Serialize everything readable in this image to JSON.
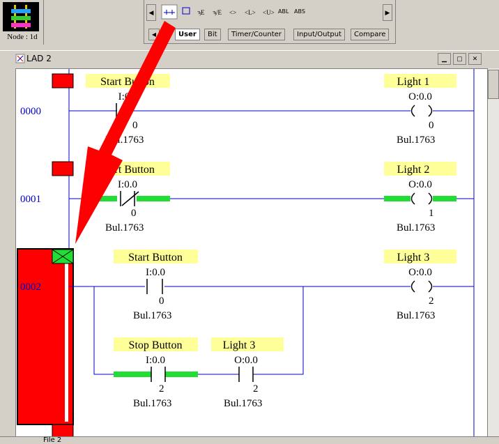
{
  "node": {
    "label": "Node : 1d"
  },
  "instruction_tabs": [
    "User",
    "Bit",
    "Timer/Counter",
    "Input/Output",
    "Compare"
  ],
  "instruction_labels": [
    "ABL",
    "ABS"
  ],
  "window": {
    "title": "LAD 2",
    "file_tab": "File 2"
  },
  "rungs": [
    {
      "number": "0000",
      "input_label": "Start Button",
      "input_addr": "I:0",
      "input_bit": "0",
      "input_bul": "Bul.1763",
      "output_label": "Light 1",
      "output_addr": "O:0.0",
      "output_bit": "0",
      "output_bul": "Bul.1763"
    },
    {
      "number": "0001",
      "input_label": "Start Button",
      "input_addr": "I:0.0",
      "input_bit": "0",
      "input_bul": "Bul.1763",
      "output_label": "Light 2",
      "output_addr": "O:0.0",
      "output_bit": "1",
      "output_bul": "Bul.1763"
    },
    {
      "number": "0002",
      "input_label": "Start Button",
      "input_addr": "I:0.0",
      "input_bit": "0",
      "input_bul": "Bul.1763",
      "output_label": "Light 3",
      "output_addr": "O:0.0",
      "output_bit": "2",
      "output_bul": "Bul.1763",
      "branch_a_label": "Stop Button",
      "branch_a_addr": "I:0.0",
      "branch_a_bit": "2",
      "branch_a_bul": "Bul.1763",
      "branch_b_label": "Light 3",
      "branch_b_addr": "O:0.0",
      "branch_b_bit": "2",
      "branch_b_bul": "Bul.1763"
    }
  ],
  "colors": {
    "rail": "#0000c8",
    "energized": "#22dd33",
    "label_bg": "#ffff99",
    "marker": "#ff0000",
    "arrow": "#ff0000"
  }
}
